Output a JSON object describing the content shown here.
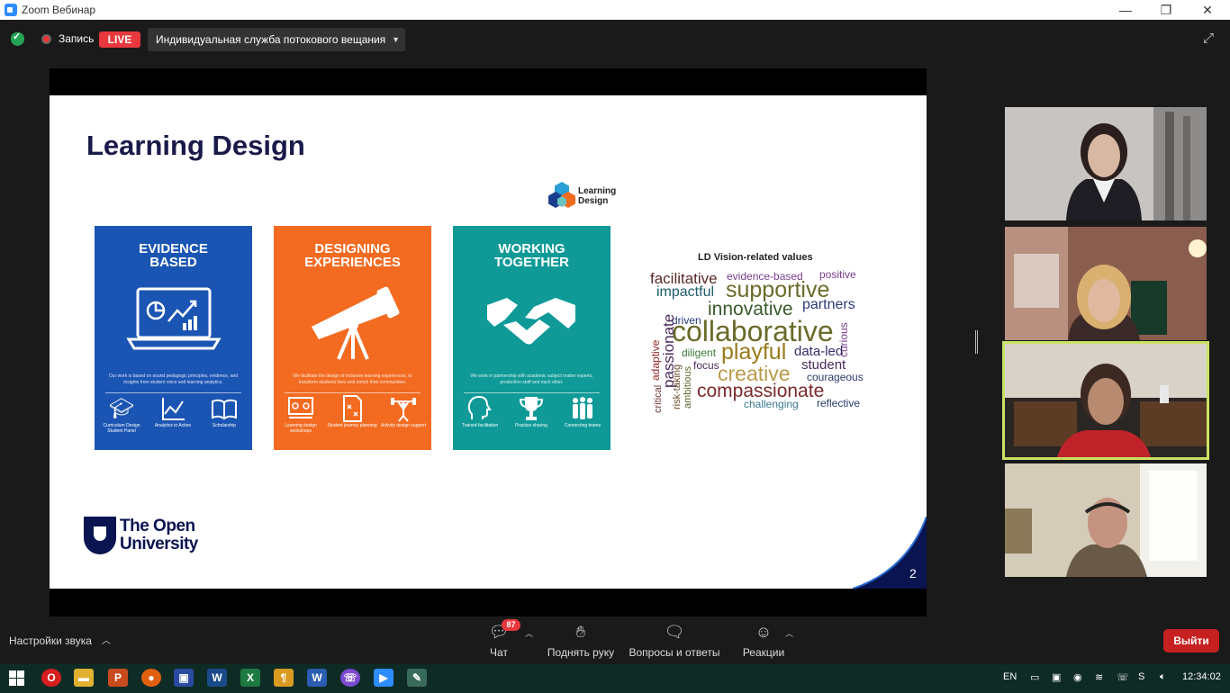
{
  "window": {
    "title": "Zoom Вебинар"
  },
  "topbar": {
    "recording_label": "Запись",
    "live_badge": "LIVE",
    "stream_service": "Индивидуальная служба потокового вещания"
  },
  "slide": {
    "title": "Learning Design",
    "logo_text_line1": "Learning",
    "logo_text_line2": "Design",
    "cards": [
      {
        "title_line1": "EVIDENCE",
        "title_line2": "BASED",
        "color": "#1b55b3",
        "description": "Our work is based on sound pedagogic principles, evidence, and insights from student voice and learning analytics.",
        "items": [
          "Curriculum Design Student Panel",
          "Analytics in Action",
          "Scholarship"
        ]
      },
      {
        "title_line1": "DESIGNING",
        "title_line2": "EXPERIENCES",
        "color": "#f26b21",
        "description": "We facilitate the design of inclusive learning experiences, to transform students lives and enrich their communities.",
        "items": [
          "Learning design workshops",
          "Student journey planning",
          "Activity design support"
        ]
      },
      {
        "title_line1": "WORKING",
        "title_line2": "TOGETHER",
        "color": "#0f9a98",
        "description": "We work in partnership with academic subject matter experts, production staff and each other.",
        "items": [
          "Trained facilitation",
          "Practice sharing",
          "Connecting teams"
        ]
      }
    ],
    "wordcloud": {
      "title": "LD Vision-related values",
      "words": [
        "facilitative",
        "evidence-based",
        "positive",
        "impactful",
        "supportive",
        "innovative",
        "partners",
        "driven",
        "collaborative",
        "curious",
        "passionate",
        "adaptive",
        "playful",
        "data-led",
        "diligent",
        "focus",
        "student",
        "critical",
        "risk-taking",
        "ambitious",
        "creative",
        "courageous",
        "compassionate",
        "challenging",
        "reflective"
      ]
    },
    "university_line1": "The Open",
    "university_line2": "University",
    "page_number": "2"
  },
  "bottombar": {
    "audio_settings": "Настройки звука",
    "chat_label": "Чат",
    "chat_badge": "87",
    "raise_hand_label": "Поднять руку",
    "qa_label": "Вопросы и ответы",
    "reactions_label": "Реакции",
    "exit_label": "Выйти"
  },
  "taskbar": {
    "language": "EN",
    "time": "12:34:02"
  },
  "colors": {
    "live_red": "#e8383d",
    "active_speaker": "#c9e265",
    "exit_red": "#c62020",
    "taskbar": "#0f2b26"
  }
}
